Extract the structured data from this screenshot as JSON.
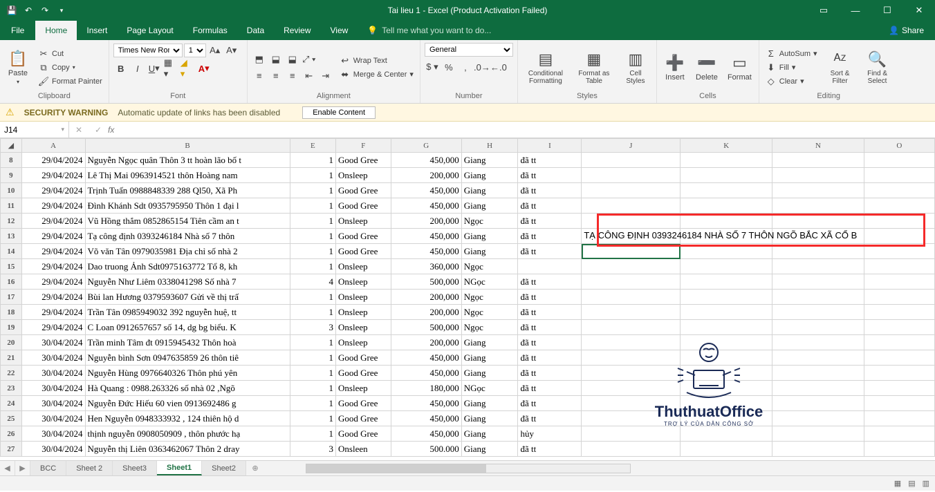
{
  "window_title": "Tai lieu 1 - Excel (Product Activation Failed)",
  "tabs": {
    "file": "File",
    "items": [
      "Home",
      "Insert",
      "Page Layout",
      "Formulas",
      "Data",
      "Review",
      "View"
    ],
    "active": "Home",
    "tell_me": "Tell me what you want to do...",
    "share": "Share"
  },
  "ribbon": {
    "clipboard": {
      "paste": "Paste",
      "cut": "Cut",
      "copy": "Copy",
      "format_painter": "Format Painter",
      "label": "Clipboard"
    },
    "font": {
      "name": "Times New Roma",
      "size": "13",
      "label": "Font"
    },
    "alignment": {
      "wrap": "Wrap Text",
      "merge": "Merge & Center",
      "label": "Alignment"
    },
    "number": {
      "format": "General",
      "label": "Number"
    },
    "styles": {
      "cond": "Conditional Formatting",
      "fmt": "Format as Table",
      "cell": "Cell Styles",
      "label": "Styles"
    },
    "cells": {
      "insert": "Insert",
      "delete": "Delete",
      "format": "Format",
      "label": "Cells"
    },
    "editing": {
      "autosum": "AutoSum",
      "fill": "Fill",
      "clear": "Clear",
      "sort": "Sort & Filter",
      "find": "Find & Select",
      "label": "Editing"
    }
  },
  "security": {
    "warn": "SECURITY WARNING",
    "msg": "Automatic update of links has been disabled",
    "btn": "Enable Content"
  },
  "cellref": "J14",
  "formula": "",
  "columns": [
    "A",
    "B",
    "E",
    "F",
    "G",
    "H",
    "I",
    "J",
    "K",
    "N",
    "O"
  ],
  "rows": [
    {
      "n": 8,
      "a": "29/04/2024",
      "b": "Nguyễn Ngọc quân Thôn 3 tt hoàn lão bố t",
      "e": "1",
      "f": "Good Gree",
      "g": "450,000",
      "h": "Giang",
      "i": "đã tt"
    },
    {
      "n": 9,
      "a": "29/04/2024",
      "b": "Lê Thị Mai 0963914521 thôn Hoàng nam",
      "e": "1",
      "f": "Onsleep",
      "g": "200,000",
      "h": "Giang",
      "i": "đã tt"
    },
    {
      "n": 10,
      "a": "29/04/2024",
      "b": "Trịnh Tuấn 0988848339 288 Ql50, Xã Ph",
      "e": "1",
      "f": "Good Gree",
      "g": "450,000",
      "h": "Giang",
      "i": "đã tt"
    },
    {
      "n": 11,
      "a": "29/04/2024",
      "b": "Đình Khánh Sdt 0935795950 Thôn 1 đại l",
      "e": "1",
      "f": "Good Gree",
      "g": "450,000",
      "h": "Giang",
      "i": "đã tt"
    },
    {
      "n": 12,
      "a": "29/04/2024",
      "b": "Vũ Hồng thắm 0852865154 Tiên cầm an t",
      "e": "1",
      "f": "Onsleep",
      "g": "200,000",
      "h": "Ngọc",
      "i": "đã tt"
    },
    {
      "n": 13,
      "a": "29/04/2024",
      "b": "Tạ công định 0393246184 Nhà số 7 thôn",
      "e": "1",
      "f": "Good Gree",
      "g": "450,000",
      "h": "Giang",
      "i": "đã tt",
      "j_over": "TẠ CÔNG ĐỊNH 0393246184 NHÀ SỐ 7 THÔN NGÕ BẮC XÃ CỔ B"
    },
    {
      "n": 14,
      "a": "29/04/2024",
      "b": "Võ văn Tân 0979035981 Địa chỉ số nhà 2",
      "e": "1",
      "f": "Good Gree",
      "g": "450,000",
      "h": "Giang",
      "i": "đã tt",
      "selJ": true
    },
    {
      "n": 15,
      "a": "29/04/2024",
      "b": "Dao truong Ảnh  Sdt0975163772 Tổ 8, kh",
      "e": "1",
      "f": "Onsleep",
      "g": "360,000",
      "h": "Ngọc",
      "i": ""
    },
    {
      "n": 16,
      "a": "29/04/2024",
      "b": "Nguyễn Như Liêm 0338041298 Số nhà 7",
      "e": "4",
      "f": "Onsleep",
      "g": "500,000",
      "h": "NGọc",
      "i": "đã tt"
    },
    {
      "n": 17,
      "a": "29/04/2024",
      "b": "Bùi lan Hương 0379593607 Gửi về thị trấ",
      "e": "1",
      "f": "Onsleep",
      "g": "200,000",
      "h": "Ngọc",
      "i": "đã tt"
    },
    {
      "n": 18,
      "a": "29/04/2024",
      "b": "Trần Tân 0985949032 392  nguyễn huệ, tt",
      "e": "1",
      "f": "Onsleep",
      "g": "200,000",
      "h": "Ngọc",
      "i": "đã tt"
    },
    {
      "n": 19,
      "a": "29/04/2024",
      "b": "C Loan 0912657657 số 14, dg bg biểu. K",
      "e": "3",
      "f": "Onsleep",
      "g": "500,000",
      "h": "Ngọc",
      "i": "đã tt"
    },
    {
      "n": 20,
      "a": "30/04/2024",
      "b": " Trần minh Tâm đt 0915945432 Thôn hoà",
      "e": "1",
      "f": "Onsleep",
      "g": "200,000",
      "h": "Giang",
      "i": "đã tt"
    },
    {
      "n": 21,
      "a": "30/04/2024",
      "b": "Nguyễn bình Sơn 0947635859 26 thôn tiê",
      "e": "1",
      "f": "Good Gree",
      "g": "450,000",
      "h": "Giang",
      "i": "đã tt"
    },
    {
      "n": 22,
      "a": "30/04/2024",
      "b": "Nguyễn Hùng 0976640326 Thôn phú yên",
      "e": "1",
      "f": "Good Gree",
      "g": "450,000",
      "h": "Giang",
      "i": "đã tt"
    },
    {
      "n": 23,
      "a": "30/04/2024",
      "b": "Hà Quang : 0988.263326 số nhà 02 ,Ngõ",
      "e": "1",
      "f": "Onsleep",
      "g": "180,000",
      "h": "NGọc",
      "i": "đã tt"
    },
    {
      "n": 24,
      "a": "30/04/2024",
      "b": "Nguyễn Đức Hiếu 60 vien 0913692486 g",
      "e": "1",
      "f": "Good Gree",
      "g": "450,000",
      "h": "Giang",
      "i": "đã tt"
    },
    {
      "n": 25,
      "a": "30/04/2024",
      "b": "Hen Nguyễn 0948333932 , 124 thiên hộ d",
      "e": "1",
      "f": "Good Gree",
      "g": "450,000",
      "h": "Giang",
      "i": "đã tt"
    },
    {
      "n": 26,
      "a": "30/04/2024",
      "b": "thịnh nguyễn 0908050909 , thôn phước hạ",
      "e": "1",
      "f": "Good Gree",
      "g": "450,000",
      "h": "Giang",
      "i": "hủy"
    },
    {
      "n": 27,
      "a": "30/04/2024",
      "b": "Nguyễn thị Liên 0363462067 Thôn 2 dray",
      "e": "3",
      "f": "Onsleen",
      "g": "500.000",
      "h": "Giang",
      "i": "đã tt"
    }
  ],
  "sheets": {
    "list": [
      "BCC",
      "Sheet 2",
      "Sheet3",
      "Sheet1",
      "Sheet2"
    ],
    "active": "Sheet1"
  },
  "watermark": {
    "brand": "ThuthuatOffice",
    "tag": "TRỢ LÝ CỦA DÂN CÔNG SỞ"
  }
}
